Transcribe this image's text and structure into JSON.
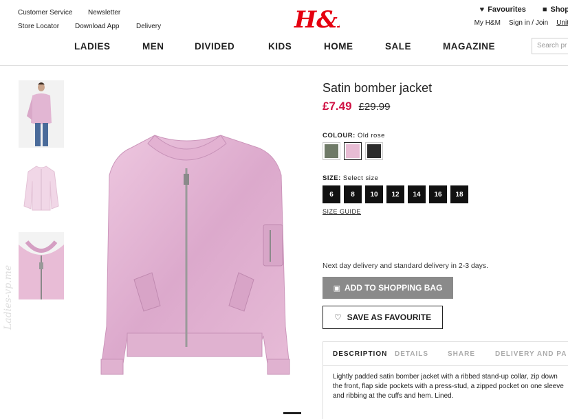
{
  "header": {
    "top_left": {
      "row1": [
        "Customer Service",
        "Newsletter"
      ],
      "row2": [
        "Store Locator",
        "Download App",
        "Delivery"
      ]
    },
    "logo": "H&M",
    "top_right": {
      "favourites": "Favourites",
      "shopping_bag": "Shop",
      "my_hm": "My H&M",
      "sign_in": "Sign in / Join",
      "unit": "Unit"
    },
    "nav": [
      "LADIES",
      "MEN",
      "DIVIDED",
      "KIDS",
      "HOME",
      "SALE",
      "MAGAZINE"
    ],
    "search_placeholder": "Search pr"
  },
  "product": {
    "title": "Satin bomber jacket",
    "price_now": "£7.49",
    "price_was": "£29.99",
    "colour_label": "COLOUR:",
    "colour_value": "Old rose",
    "colours": [
      {
        "name": "khaki",
        "hex": "#6f7a67"
      },
      {
        "name": "old-rose",
        "hex": "#e8bcd4"
      },
      {
        "name": "black",
        "hex": "#2b2b2b"
      }
    ],
    "size_label": "SIZE:",
    "size_value": "Select size",
    "sizes": [
      "6",
      "8",
      "10",
      "12",
      "14",
      "16",
      "18"
    ],
    "size_guide": "SIZE GUIDE",
    "delivery_note": "Next day delivery and standard delivery in 2-3 days.",
    "add_to_bag": "ADD TO SHOPPING BAG",
    "save_favourite": "SAVE AS FAVOURITE",
    "tabs": [
      "DESCRIPTION",
      "DETAILS",
      "SHARE",
      "DELIVERY AND PA"
    ],
    "description": "Lightly padded satin bomber jacket with a ribbed stand-up collar, zip down the front, flap side pockets with a press-stud, a zipped pocket on one sleeve and ribbing at the cuffs and hem. Lined."
  },
  "watermark": "Ladies-vp.me",
  "colors": {
    "sale_red": "#d01345",
    "jacket_pink": "#e2b6d3",
    "button_grey": "#8a8a8a"
  }
}
